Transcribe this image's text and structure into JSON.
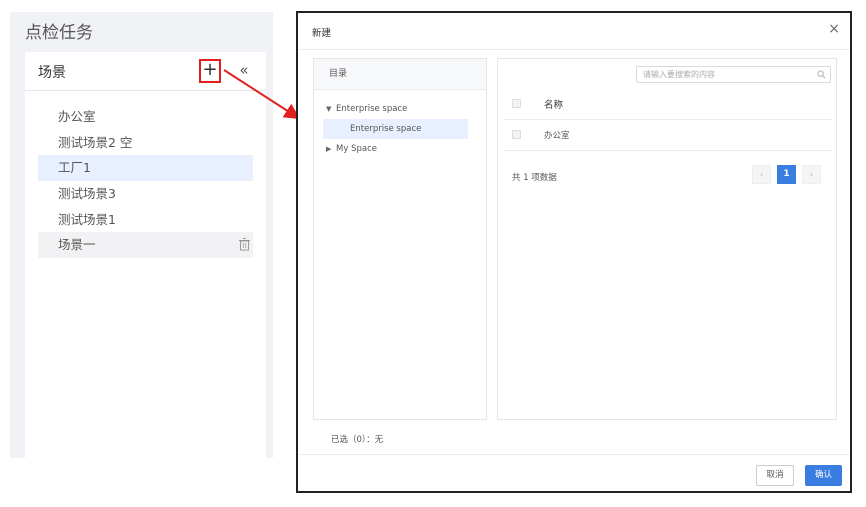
{
  "page": {
    "title": "点检任务"
  },
  "scene_panel": {
    "title": "场景",
    "add_label": "+",
    "collapse_label": "«",
    "items": [
      {
        "label": "办公室",
        "state": "normal"
      },
      {
        "label": "测试场景2 空",
        "state": "normal"
      },
      {
        "label": "工厂1",
        "state": "selected"
      },
      {
        "label": "测试场景3",
        "state": "normal"
      },
      {
        "label": "测试场景1",
        "state": "normal"
      },
      {
        "label": "场景一",
        "state": "hover"
      }
    ]
  },
  "annotation": {
    "color": "#e02020"
  },
  "modal": {
    "title": "新建",
    "close_label": "×",
    "directory": {
      "header": "目录",
      "tree": [
        {
          "label": "Enterprise space",
          "expanded": true
        },
        {
          "label": "Enterprise space",
          "child": true,
          "selected": true
        },
        {
          "label": "My Space",
          "expanded": false
        }
      ]
    },
    "table": {
      "search_placeholder": "请输入要搜索的内容",
      "column_name": "名称",
      "rows": [
        {
          "name": "办公室"
        }
      ],
      "total_text": "共 1 项数据",
      "pagination": {
        "prev": "‹",
        "current": "1",
        "next": "›"
      }
    },
    "selected_text": "已选（0）：无",
    "buttons": {
      "cancel": "取消",
      "confirm": "确认"
    }
  },
  "colors": {
    "accent": "#3a7de0",
    "selected_bg": "#e8efff",
    "panel_bg": "#f0f2f5"
  }
}
